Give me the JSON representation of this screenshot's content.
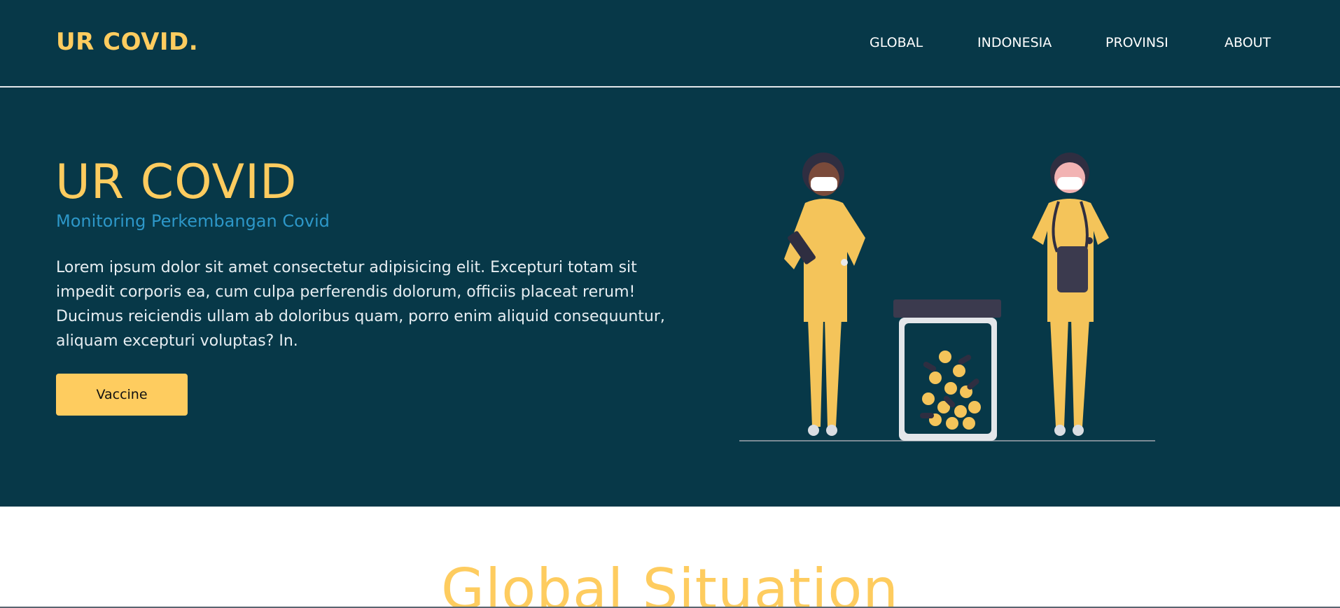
{
  "header": {
    "logo": "UR COVID.",
    "nav": [
      "GLOBAL",
      "INDONESIA",
      "PROVINSI",
      "ABOUT"
    ]
  },
  "hero": {
    "title": "UR COVID",
    "subtitle": "Monitoring Perkembangan Covid",
    "description": "Lorem ipsum dolor sit amet consectetur adipisicing elit. Excepturi totam sit impedit corporis ea, cum culpa perferendis dolorum, officiis placeat rerum! Ducimus reiciendis ullam ab doloribus quam, porro enim aliquid consequuntur, aliquam excepturi voluptas? In.",
    "button_label": "Vaccine"
  },
  "section": {
    "title": "Global Situation"
  },
  "colors": {
    "background_dark": "#073848",
    "accent_yellow": "#fecc5f",
    "subtitle_blue": "#2d97c8"
  },
  "icons": [
    "doctor-illustration",
    "nurse-illustration",
    "pill-jar-illustration"
  ]
}
